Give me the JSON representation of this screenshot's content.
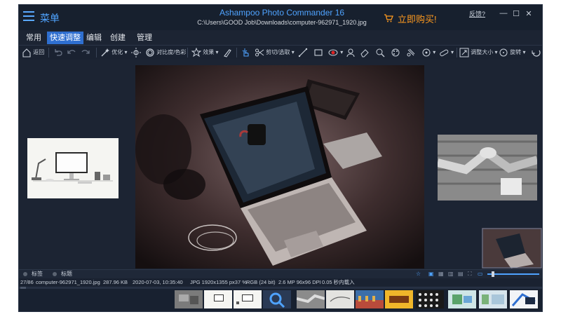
{
  "window": {
    "menu_label": "菜单",
    "app_title": "Ashampoo Photo Commander 16",
    "file_path": "C:\\Users\\GOOD Job\\Downloads\\computer-962971_1920.jpg",
    "buy_label": "立即购买!",
    "feedback_label": "反馈?",
    "accent_color": "#4fa3ff",
    "buy_color": "#ff9a1f"
  },
  "tabs": [
    {
      "label": "常用"
    },
    {
      "label": "快速调整",
      "active": true
    },
    {
      "label": "编辑"
    },
    {
      "label": "创建"
    },
    {
      "label": "管理"
    }
  ],
  "toolbar": {
    "back_label": "返回",
    "optimize_label": "优化",
    "contrast_label": "对比度/色彩",
    "effects_label": "效果",
    "cut_label": "剪切/选取",
    "resize_label": "调整大小",
    "rotate_label": "旋转"
  },
  "bottom_tabs": {
    "tags_label": "标签",
    "title_label": "标题"
  },
  "status": {
    "index": "27/86",
    "filename": "computer-962971_1920.jpg",
    "size": "287.96 KB",
    "datetime": "2020-07-03, 10:35:40",
    "info": "JPG 1920x1355 px37 %",
    "color": "RGB (24 bit)",
    "megapixels": "2.6 MP 96x96 DPI",
    "load_time": "0.05 秒内载入"
  },
  "filmstrip_count": 12
}
